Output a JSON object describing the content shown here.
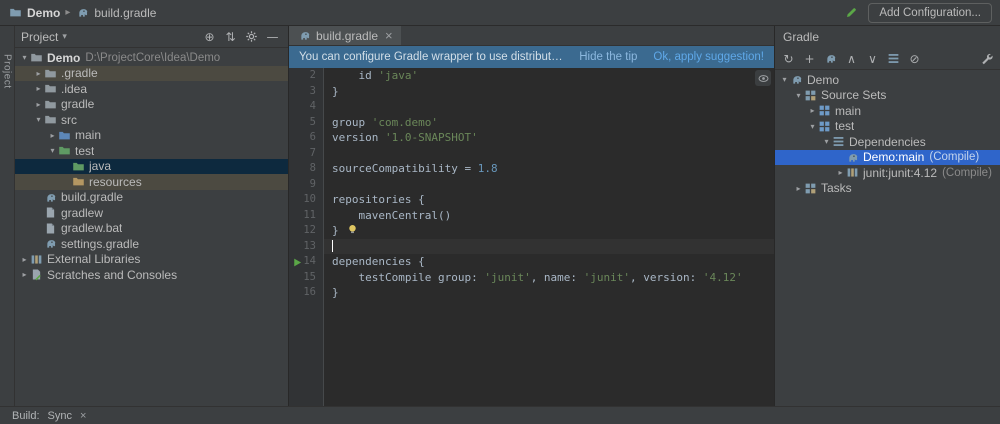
{
  "colors": {
    "selection_blue": "#2f65ca",
    "highlight_olive": "#4c4a41",
    "selection_inactive": "#0d293e",
    "accent_green": "#5ba747",
    "string_green": "#6a8759",
    "number_blue": "#6897bb"
  },
  "topbar": {
    "project_name": "Demo",
    "file_name": "build.gradle",
    "add_configuration_label": "Add Configuration...",
    "icons": [
      "project-folder-icon",
      "chevron-right-icon",
      "gradle-icon",
      "pencil-icon"
    ]
  },
  "tool_strip": {
    "label": "Project"
  },
  "project_panel": {
    "title": "Project",
    "toolbar_icons": [
      "locate-icon",
      "scroll-to-source-icon",
      "settings-icon",
      "hide-icon"
    ],
    "items": [
      {
        "label": "Demo",
        "hint": "D:\\ProjectCore\\Idea\\Demo",
        "level": 0,
        "arrow": "expanded",
        "icon": "folder-icon",
        "bold": true
      },
      {
        "label": ".gradle",
        "level": 1,
        "arrow": "collapsed",
        "icon": "folder-icon",
        "highlight": "olive"
      },
      {
        "label": ".idea",
        "level": 1,
        "arrow": "collapsed",
        "icon": "folder-icon"
      },
      {
        "label": "gradle",
        "level": 1,
        "arrow": "collapsed",
        "icon": "folder-icon"
      },
      {
        "label": "src",
        "level": 1,
        "arrow": "expanded",
        "icon": "folder-icon"
      },
      {
        "label": "main",
        "level": 2,
        "arrow": "collapsed",
        "icon": "folder-source-icon"
      },
      {
        "label": "test",
        "level": 2,
        "arrow": "expanded",
        "icon": "folder-test-icon"
      },
      {
        "label": "java",
        "level": 3,
        "icon": "folder-test-icon",
        "highlight": "inactive"
      },
      {
        "label": "resources",
        "level": 3,
        "icon": "folder-resources-icon",
        "highlight": "olive"
      },
      {
        "label": "build.gradle",
        "level": 1,
        "icon": "gradle-icon"
      },
      {
        "label": "gradlew",
        "level": 1,
        "icon": "file-icon"
      },
      {
        "label": "gradlew.bat",
        "level": 1,
        "icon": "file-icon"
      },
      {
        "label": "settings.gradle",
        "level": 1,
        "icon": "gradle-icon"
      },
      {
        "label": "External Libraries",
        "level": 0,
        "arrow": "collapsed",
        "icon": "library-icon"
      },
      {
        "label": "Scratches and Consoles",
        "level": 0,
        "arrow": "collapsed",
        "icon": "scratches-icon"
      }
    ]
  },
  "editor": {
    "tab": {
      "icon": "gradle-icon",
      "label": "build.gradle",
      "close_glyph": "×"
    },
    "banner": {
      "message": "You can configure Gradle wrapper to use distribution with sourc...",
      "hide_link": "Hide the tip",
      "apply_link": "Ok, apply suggestion!"
    },
    "lines": [
      {
        "n": 2,
        "tokens": [
          {
            "t": "    id ",
            "c": "plain"
          },
          {
            "t": "'java'",
            "c": "string"
          }
        ]
      },
      {
        "n": 3,
        "tokens": [
          {
            "t": "}",
            "c": "plain"
          }
        ]
      },
      {
        "n": 4,
        "tokens": []
      },
      {
        "n": 5,
        "tokens": [
          {
            "t": "group ",
            "c": "plain"
          },
          {
            "t": "'com.demo'",
            "c": "string"
          }
        ]
      },
      {
        "n": 6,
        "tokens": [
          {
            "t": "version ",
            "c": "plain"
          },
          {
            "t": "'1.0-SNAPSHOT'",
            "c": "string"
          }
        ]
      },
      {
        "n": 7,
        "tokens": []
      },
      {
        "n": 8,
        "tokens": [
          {
            "t": "sourceCompatibility = ",
            "c": "plain"
          },
          {
            "t": "1.8",
            "c": "number"
          }
        ]
      },
      {
        "n": 9,
        "tokens": []
      },
      {
        "n": 10,
        "tokens": [
          {
            "t": "repositories {",
            "c": "plain"
          }
        ]
      },
      {
        "n": 11,
        "tokens": [
          {
            "t": "    mavenCentral()",
            "c": "plain"
          }
        ]
      },
      {
        "n": 12,
        "tokens": [
          {
            "t": "}",
            "c": "plain"
          }
        ],
        "bulb": true
      },
      {
        "n": 13,
        "tokens": [],
        "caret": true
      },
      {
        "n": 14,
        "tokens": [
          {
            "t": "dependencies {",
            "c": "plain"
          }
        ],
        "run": true
      },
      {
        "n": 15,
        "tokens": [
          {
            "t": "    testCompile group: ",
            "c": "plain"
          },
          {
            "t": "'junit'",
            "c": "string"
          },
          {
            "t": ", name: ",
            "c": "plain"
          },
          {
            "t": "'junit'",
            "c": "string"
          },
          {
            "t": ", version: ",
            "c": "plain"
          },
          {
            "t": "'4.12'",
            "c": "string"
          }
        ]
      },
      {
        "n": 16,
        "tokens": [
          {
            "t": "}",
            "c": "plain"
          }
        ]
      }
    ]
  },
  "gradle_panel": {
    "title": "Gradle",
    "toolbar_icons": [
      "refresh-icon",
      "add-icon",
      "gradle-sync-icon",
      "expand-all-icon",
      "collapse-all-icon",
      "dependencies-icon",
      "offline-mode-icon",
      "wrench-icon"
    ],
    "items": [
      {
        "label": "Demo",
        "level": 0,
        "arrow": "expanded",
        "icon": "gradle-icon"
      },
      {
        "label": "Source Sets",
        "level": 1,
        "arrow": "expanded",
        "icon": "modules-icon"
      },
      {
        "label": "main",
        "level": 2,
        "arrow": "collapsed",
        "icon": "sourceset-icon"
      },
      {
        "label": "test",
        "level": 2,
        "arrow": "expanded",
        "icon": "sourceset-icon"
      },
      {
        "label": "Dependencies",
        "level": 3,
        "arrow": "expanded",
        "icon": "dependencies-icon"
      },
      {
        "label": "Demo:main",
        "hint": "(Compile)",
        "level": 4,
        "icon": "gradle-icon",
        "highlight": "blue"
      },
      {
        "label": "junit:junit:4.12",
        "hint": "(Compile)",
        "level": 4,
        "arrow": "collapsed",
        "icon": "library-icon"
      },
      {
        "label": "Tasks",
        "level": 1,
        "arrow": "collapsed",
        "icon": "modules-icon"
      }
    ]
  },
  "statusbar": {
    "build_label": "Build:",
    "sync_label": "Sync",
    "close_glyph": "×"
  }
}
